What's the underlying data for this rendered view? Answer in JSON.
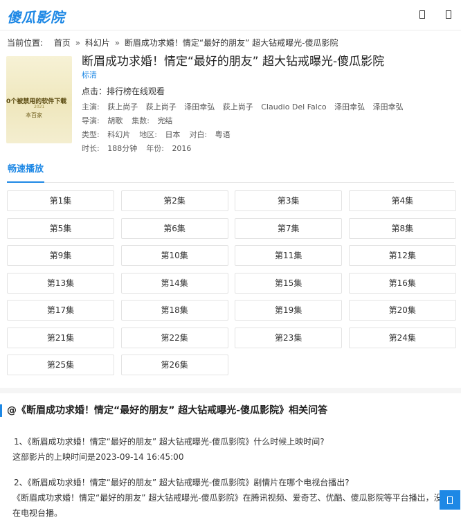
{
  "site": {
    "logo": "傻瓜影院"
  },
  "header": {
    "icons": [
      "search-icon",
      "user-icon"
    ]
  },
  "breadcrumb": {
    "label": "当前位置:",
    "items": [
      "首页",
      "科幻片",
      "断眉成功求婚！情定“最好的朋友” 超大钻戒曝光-傻瓜影院"
    ],
    "separator": "»"
  },
  "poster": {
    "line1": "0个被禁用的软件下载",
    "line2": "本百家",
    "line3": "2021"
  },
  "movie": {
    "title": "断眉成功求婚！情定“最好的朋友” 超大钻戒曝光-傻瓜影院",
    "quality": "标清",
    "clicks": "点击：排行榜在线观看",
    "cast_label": "主演:",
    "cast": [
      "荻上尚子",
      "荻上尚子",
      "泽田幸弘",
      "荻上尚子",
      "Claudio Del Falco",
      "泽田幸弘",
      "泽田幸弘"
    ],
    "director_label": "导演:",
    "director": "胡歌",
    "episodes_label": "集数:",
    "episodes_status": "完结",
    "type_label": "类型:",
    "type": "科幻片",
    "region_label": "地区:",
    "region": "日本",
    "dialogue_label": "对白:",
    "dialogue": "粤语",
    "duration_label": "时长:",
    "duration": "188分钟",
    "year_label": "年份:",
    "year": "2016"
  },
  "tabs": [
    {
      "label": "畅速播放"
    }
  ],
  "episodes": [
    "第1集",
    "第2集",
    "第3集",
    "第4集",
    "第5集",
    "第6集",
    "第7集",
    "第8集",
    "第9集",
    "第10集",
    "第11集",
    "第12集",
    "第13集",
    "第14集",
    "第15集",
    "第16集",
    "第17集",
    "第18集",
    "第19集",
    "第20集",
    "第21集",
    "第22集",
    "第23集",
    "第24集",
    "第25集",
    "第26集"
  ],
  "qa": {
    "heading": "@《断眉成功求婚！情定“最好的朋友” 超大钻戒曝光-傻瓜影院》相关问答",
    "items": [
      {
        "q": "1、《断眉成功求婚！情定“最好的朋友” 超大钻戒曝光-傻瓜影院》什么时候上映时间?",
        "a": "这部影片的上映时间是2023-09-14 16:45:00"
      },
      {
        "q": "2、《断眉成功求婚！情定“最好的朋友” 超大钻戒曝光-傻瓜影院》剧情片在哪个电视台播出?",
        "a": "《断眉成功求婚！情定“最好的朋友” 超大钻戒曝光-傻瓜影院》在腾讯视频、爱奇艺、优酷、傻瓜影院等平台播出，没有在电视台播。"
      }
    ]
  },
  "float_button": {
    "icon": "back-to-top-icon"
  }
}
